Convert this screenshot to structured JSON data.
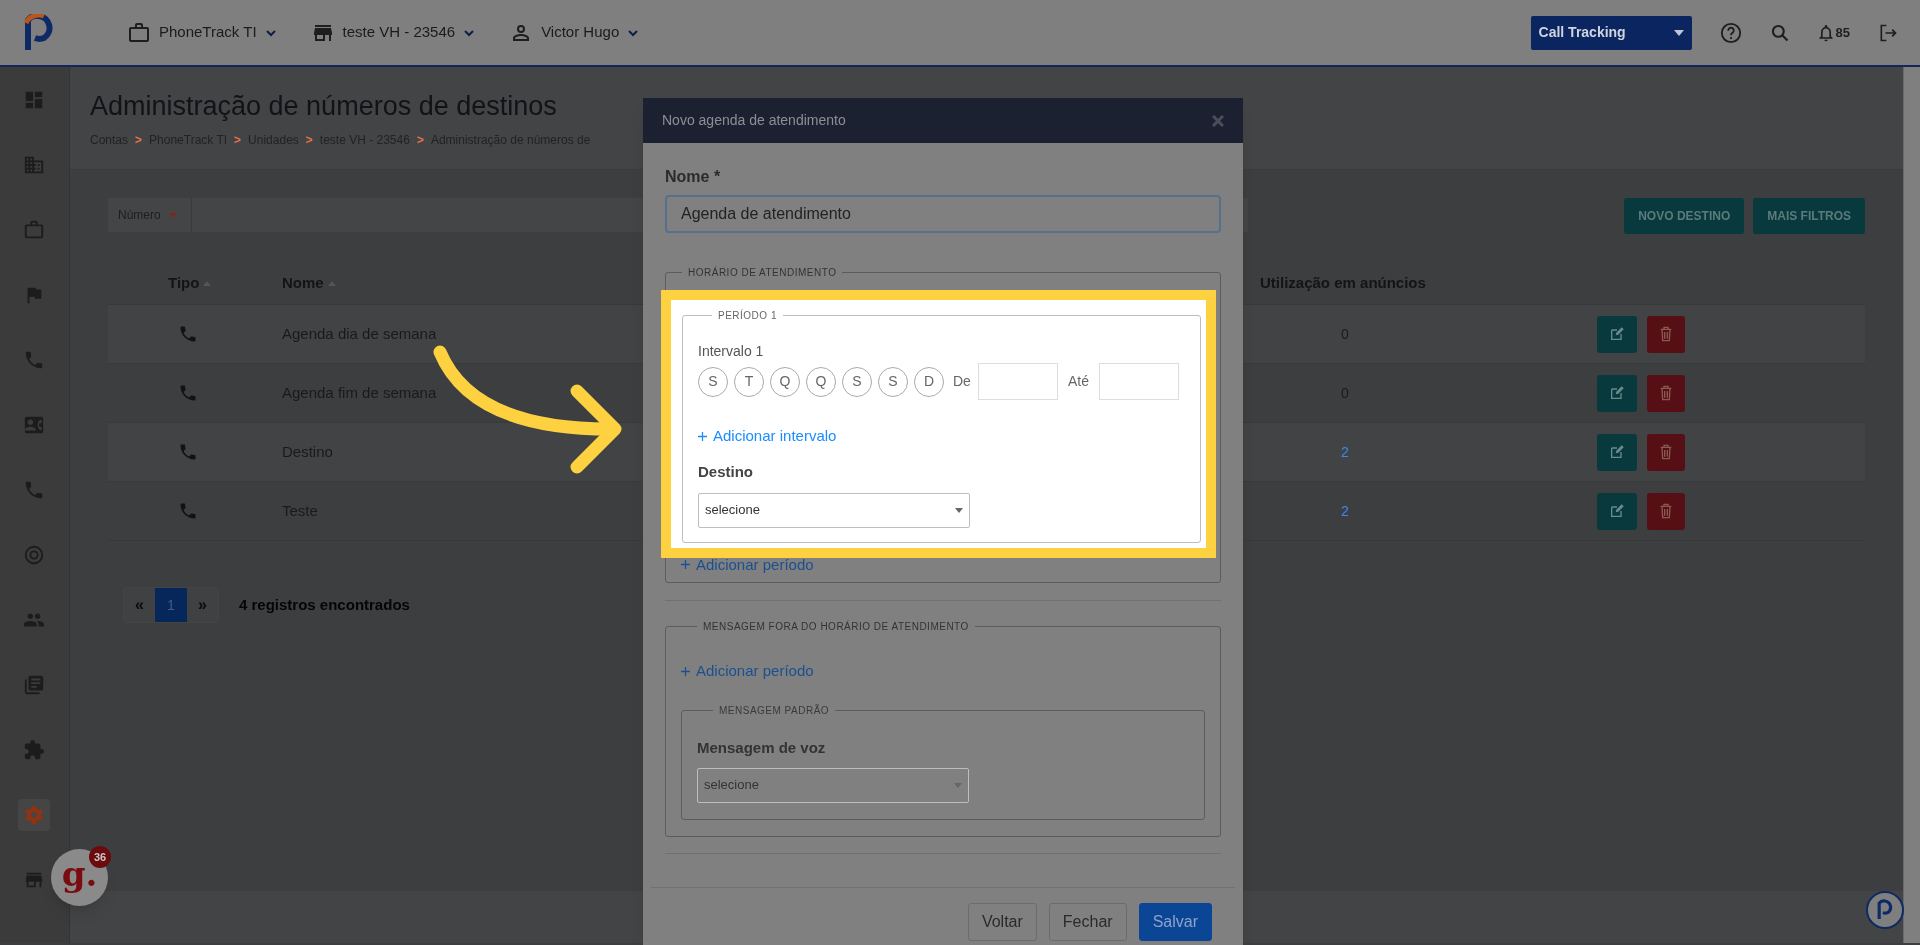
{
  "top_bar": {
    "account": "PhoneTrack TI",
    "unit": "teste VH - 23546",
    "user": "Victor Hugo",
    "product": "Call Tracking",
    "notifications": "85"
  },
  "sidebar": {
    "items": [
      {
        "selected": false
      },
      {
        "selected": false
      },
      {
        "selected": false
      },
      {
        "selected": false
      },
      {
        "selected": false
      },
      {
        "selected": false
      },
      {
        "selected": false
      },
      {
        "selected": false
      },
      {
        "selected": false
      },
      {
        "selected": false
      },
      {
        "selected": false
      },
      {
        "selected": true
      },
      {
        "selected": false
      }
    ]
  },
  "page": {
    "title": "Administração de números de destinos",
    "breadcrumb": [
      {
        "label": "Contas",
        "separator": ">"
      },
      {
        "label": "PhoneTrack TI",
        "separator": ">"
      },
      {
        "label": "Unidades",
        "separator": ">"
      },
      {
        "label": "teste VH - 23546",
        "separator": ">"
      },
      {
        "label": "Administração de números de"
      }
    ]
  },
  "filter": {
    "field": "Número"
  },
  "actions": [
    "NOVO DESTINO",
    "MAIS FILTROS"
  ],
  "table": {
    "columns": [
      {
        "label": "Tipo",
        "sortable": true
      },
      {
        "label": "Nome",
        "sortable": true
      },
      {
        "label": "Utilização em anúncios",
        "sortable": false
      }
    ],
    "rows": [
      {
        "name": "Agenda dia de semana",
        "usage": "0",
        "usage_link": false
      },
      {
        "name": "Agenda fim de semana",
        "usage": "0",
        "usage_link": false
      },
      {
        "name": "Destino",
        "usage": "2",
        "usage_link": true
      },
      {
        "name": "Teste",
        "usage": "2",
        "usage_link": true
      }
    ]
  },
  "pagination": {
    "prev": "«",
    "next": "»",
    "pages": [
      {
        "label": "1",
        "selected": true
      }
    ],
    "summary": "4 registros encontrados"
  },
  "modal": {
    "title": "Novo agenda de atendimento",
    "name_label": "Nome *",
    "name_value": "Agenda de atendimento",
    "schedule_legend": "HORÁRIO DE ATENDIMENTO",
    "period": {
      "legend": "PERÍODO 1",
      "interval_label": "Intervalo 1",
      "days": [
        {
          "label": "S",
          "selected": false
        },
        {
          "label": "T",
          "selected": false
        },
        {
          "label": "Q",
          "selected": false
        },
        {
          "label": "Q",
          "selected": false
        },
        {
          "label": "S",
          "selected": false
        },
        {
          "label": "S",
          "selected": false
        },
        {
          "label": "D",
          "selected": false
        }
      ],
      "from_label": "De",
      "to_label": "Até",
      "add_interval": "Adicionar intervalo",
      "destination_label": "Destino",
      "destination_select": "selecione"
    },
    "add_period": "Adicionar período",
    "off_hours": {
      "legend": "MENSAGEM FORA DO HORÁRIO DE ATENDIMENTO",
      "add_period": "Adicionar período",
      "default_legend": "MENSAGEM PADRÃO",
      "voice_label": "Mensagem de voz",
      "voice_select": "selecione"
    },
    "buttons": [
      {
        "label": "Voltar",
        "kind": "secondary"
      },
      {
        "label": "Fechar",
        "kind": "secondary"
      },
      {
        "label": "Salvar",
        "kind": "primary"
      }
    ]
  },
  "chat_widget": {
    "logo": "g.",
    "badge": "36"
  }
}
